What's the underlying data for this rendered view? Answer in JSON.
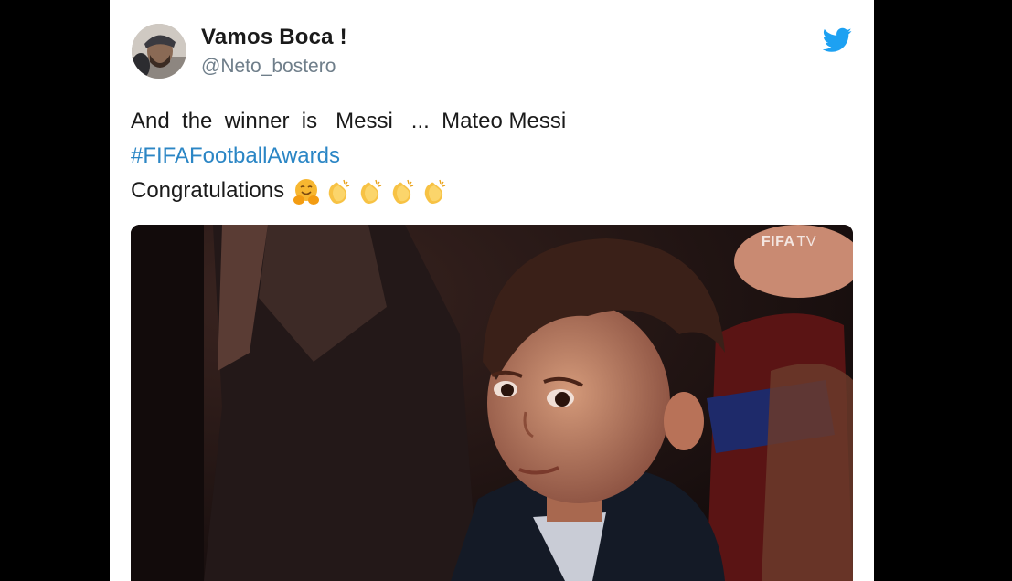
{
  "tweet": {
    "display_name": "Vamos Boca !",
    "handle": "@Neto_bostero",
    "text_line1": "And  the  winner  is   Messi   ...  Mateo Messi",
    "hashtag": "#FIFAFootballAwards",
    "text_line3": "Congratulations",
    "emojis": [
      "hugging-face-emoji",
      "clapping-hands-emoji",
      "clapping-hands-emoji",
      "clapping-hands-emoji",
      "clapping-hands-emoji"
    ]
  },
  "media": {
    "watermark_brand": "FIFA",
    "watermark_suffix": "TV"
  },
  "colors": {
    "background": "#000000",
    "card": "#ffffff",
    "hashtag": "#2b86c5",
    "handle": "#6f7e8a",
    "twitter_blue": "#1da1f2"
  },
  "icons": {
    "brand": "twitter-bird-icon",
    "avatar": "user-avatar"
  }
}
